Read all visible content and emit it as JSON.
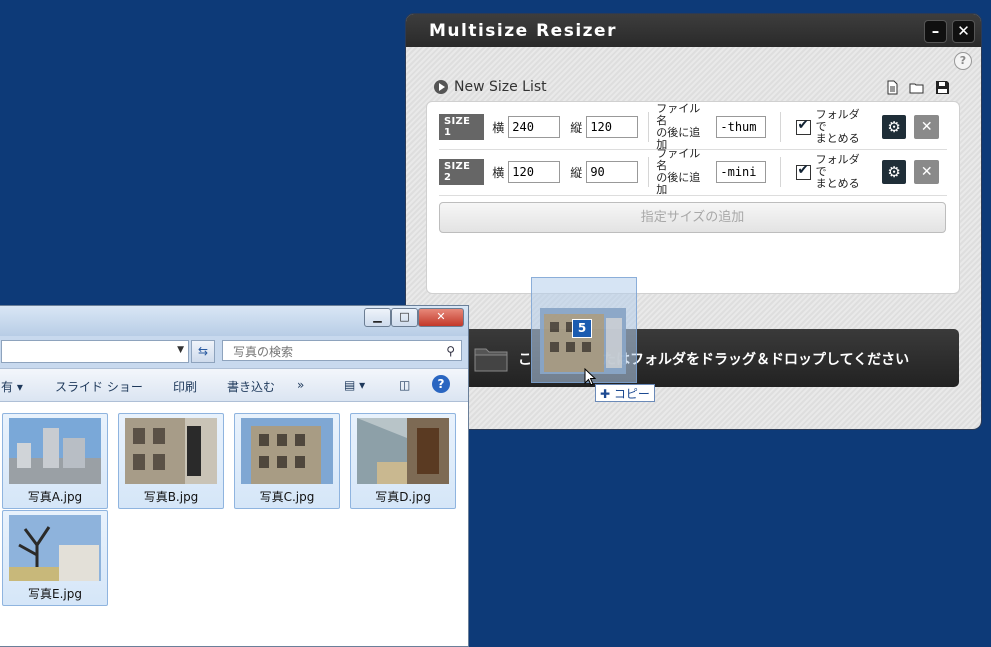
{
  "resizer": {
    "title": "Multisize Resizer",
    "minimize_glyph": "–",
    "close_glyph": "✕",
    "help_glyph": "?",
    "section_label": "New Size List",
    "tools": [
      "new-doc-icon",
      "open-folder-icon",
      "save-icon"
    ],
    "sizes": [
      {
        "badge": "SIZE 1",
        "w_label": "横",
        "w_value": "240",
        "h_label": "縦",
        "h_value": "120",
        "suffix_label_1": "ファイル名",
        "suffix_label_2": "の後に追加",
        "suffix_value": "-thum",
        "folder_label_1": "フォルダで",
        "folder_label_2": "まとめる",
        "folder_checked": true
      },
      {
        "badge": "SIZE 2",
        "w_label": "横",
        "w_value": "120",
        "h_label": "縦",
        "h_value": "90",
        "suffix_label_1": "ファイル名",
        "suffix_label_2": "の後に追加",
        "suffix_value": "-mini",
        "folder_label_1": "フォルダで",
        "folder_label_2": "まとめる",
        "folder_checked": true
      }
    ],
    "add_size_label": "指定サイズの追加",
    "drop_zone_visible_left": "こ",
    "drop_zone_visible_right": "たはフォルダをドラッグ＆ドロップしてください"
  },
  "explorer": {
    "search_placeholder": "写真の検索",
    "toolbar": {
      "share_fragment": "有 ▾",
      "slideshow": "スライド ショー",
      "print": "印刷",
      "burn": "書き込む",
      "more": "»"
    },
    "files": [
      "写真A.jpg",
      "写真B.jpg",
      "写真C.jpg",
      "写真D.jpg",
      "写真E.jpg"
    ]
  },
  "drag": {
    "count": "5",
    "copy_label": "コピー"
  },
  "colors": {
    "desktop": "#0d3a78",
    "resizer_titlebar": "#2e2e2e",
    "drop_zone": "#2b2b2b",
    "drag_badge": "#1a5bb0"
  }
}
